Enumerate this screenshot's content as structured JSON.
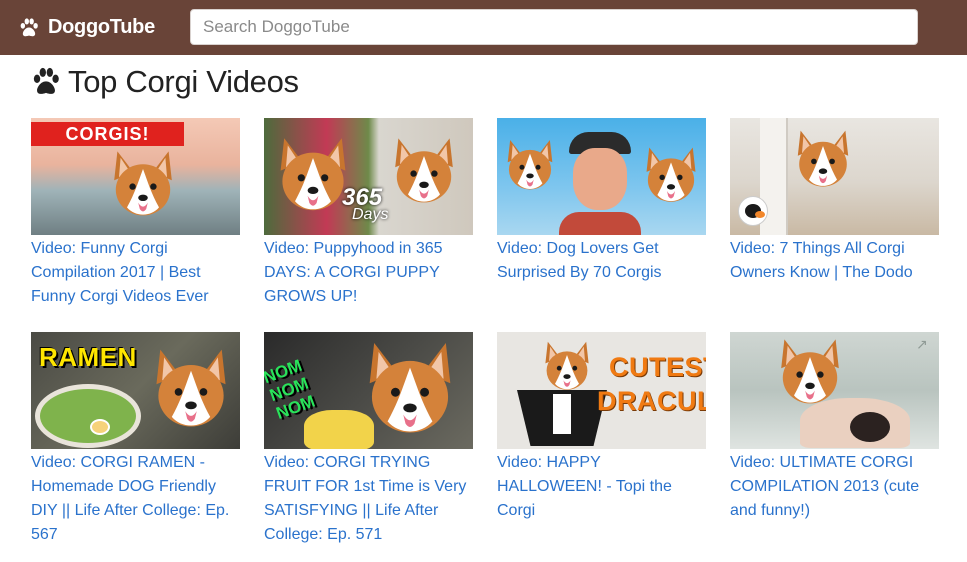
{
  "app": {
    "brand_name": "DoggoTube",
    "brand_icon": "paw-icon"
  },
  "search": {
    "placeholder": "Search DoggoTube",
    "value": ""
  },
  "page": {
    "title": "Top Corgi Videos",
    "title_icon": "paw-icon"
  },
  "colors": {
    "navbar": "#694438",
    "link": "#2a72cc"
  },
  "videos": [
    {
      "title": "Video: Funny Corgi Compilation 2017 | Best Funny Corgi Videos Ever",
      "thumb_text": "CORGIS!"
    },
    {
      "title": "Video: Puppyhood in 365 DAYS: A CORGI PUPPY GROWS UP!",
      "thumb_text": "365",
      "thumb_text2": "Days"
    },
    {
      "title": "Video: Dog Lovers Get Surprised By 70 Corgis"
    },
    {
      "title": "Video: 7 Things All Corgi Owners Know | The Dodo"
    },
    {
      "title": "Video: CORGI RAMEN - Homemade DOG Friendly DIY || Life After College: Ep. 567",
      "thumb_text": "RAMEN"
    },
    {
      "title": "Video: CORGI TRYING FRUIT FOR 1st Time is Very SATISFYING || Life After College: Ep. 571",
      "thumb_text": "NOM NOM NOM"
    },
    {
      "title": "Video: HAPPY HALLOWEEN! - Topi the Corgi",
      "thumb_text": "CUTEST",
      "thumb_text2": "DRACULA"
    },
    {
      "title": "Video: ULTIMATE CORGI COMPILATION 2013 (cute and funny!)"
    }
  ]
}
